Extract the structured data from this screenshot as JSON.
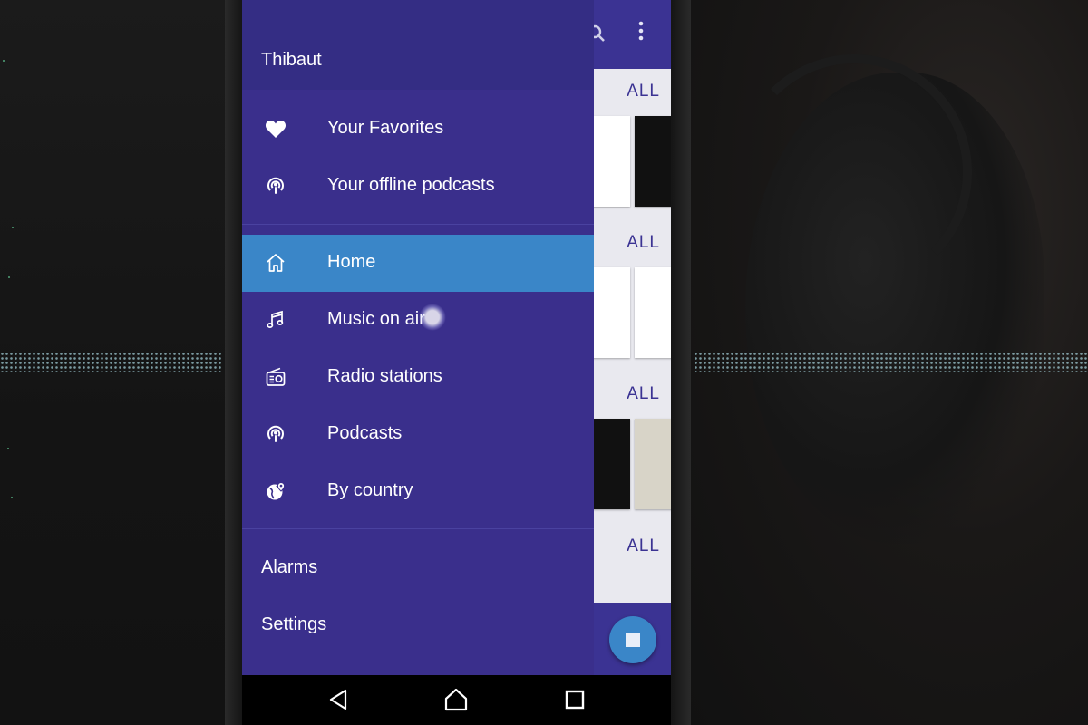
{
  "drawer": {
    "user_name": "Thibaut",
    "primary_items": [
      {
        "label": "Your Favorites",
        "icon": "heart-icon"
      },
      {
        "label": "Your offline podcasts",
        "icon": "podcast-icon"
      }
    ],
    "nav_items": [
      {
        "label": "Home",
        "icon": "home-icon",
        "active": true
      },
      {
        "label": "Music on air",
        "icon": "music-note-icon"
      },
      {
        "label": "Radio stations",
        "icon": "radio-icon"
      },
      {
        "label": "Podcasts",
        "icon": "podcast-icon"
      },
      {
        "label": "By country",
        "icon": "globe-pin-icon"
      }
    ],
    "footer_items": [
      {
        "label": "Alarms"
      },
      {
        "label": "Settings"
      }
    ]
  },
  "app": {
    "sections": [
      {
        "all_label": "ALL"
      },
      {
        "all_label": "ALL"
      },
      {
        "all_label": "ALL"
      },
      {
        "all_label": "ALL"
      }
    ]
  },
  "colors": {
    "drawer_bg": "#3a2f8c",
    "header_bg": "#342d84",
    "active_bg": "#3a86c8",
    "toolbar": "#3b3393"
  }
}
